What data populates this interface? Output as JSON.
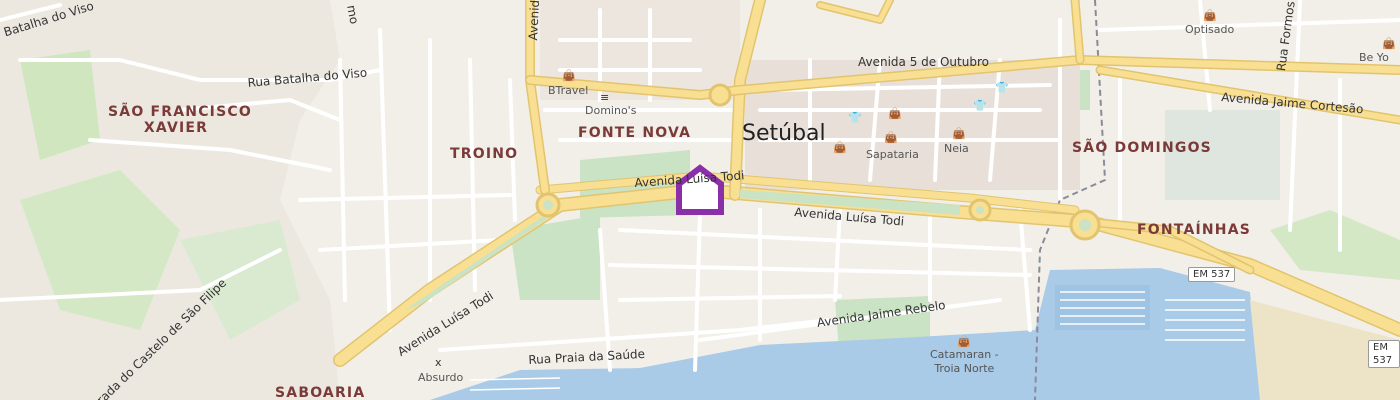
{
  "map": {
    "city": "Setúbal",
    "districts": {
      "sao_francisco_line1": "SÃO FRANCISCO",
      "sao_francisco_line2": "XAVIER",
      "troino": "TROINO",
      "fonte_nova": "FONTE NOVA",
      "sao_domingos": "SÃO DOMINGOS",
      "fontainhas": "FONTAÍNHAS",
      "saboaria": "SABOARIA"
    },
    "roads": {
      "batalha_do_viso_top": "Batalha do Viso",
      "rua_batalha_do_viso": "Rua Batalha do Viso",
      "avenida_5_de_outubro": "Avenida 5 de Outubro",
      "avenida_jaime_cortesao": "Avenida Jaime Cortesão",
      "avenida_luisa_todi_center": "Avenida Luísa Todi",
      "avenida_luisa_todi_upper": "Avenida Luísa Todi",
      "avenida_luisa_todi_west": "Avenida Luísa Todi",
      "avenida_jaime_rebelo": "Avenida Jaime Rebelo",
      "rua_praia_da_saude": "Rua Praia da Saúde",
      "estrada_castelo": "rada do Castelo de São Filipe",
      "avenida_vertical": "Avenida",
      "rua_formosa": "Rua Formos",
      "top_fragment": "mo"
    },
    "shields": {
      "em537_center": "EM 537",
      "em537_right": "EM 537"
    },
    "pois": {
      "btravel": "BTravel",
      "dominos": "Domino's",
      "sapataria": "Sapataria",
      "neia": "Neia",
      "optisado": "Optisado",
      "be_yo": "Be Yo",
      "catamaran_line1": "Catamaran -",
      "catamaran_line2": "Troia Norte",
      "absurdo": "Absurdo"
    },
    "icons": {
      "shop": "shop-icon",
      "restaurant": "restaurant-icon",
      "clothes": "clothes-icon",
      "bar": "bar-icon",
      "location": "location-marker-icon"
    },
    "colors": {
      "background": "#f2efe9",
      "water": "#a9cbe8",
      "park": "#c9e3c4",
      "main_road": "#f8df92",
      "main_road_casing": "#e2c46e",
      "street": "#ffffff",
      "district_label": "#7a3a38",
      "marker": "#8b2fa8"
    }
  }
}
